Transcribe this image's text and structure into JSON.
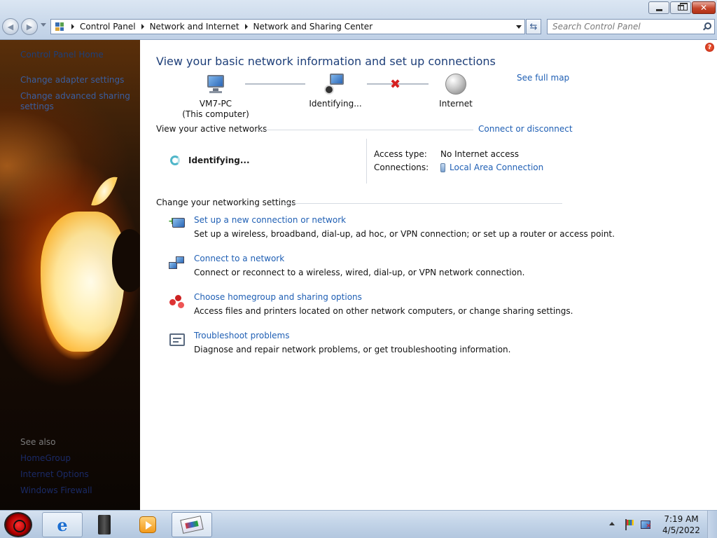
{
  "window": {
    "minimize_icon": "minimize-icon",
    "maximize_icon": "restore-icon",
    "close_icon": "close-icon",
    "close_glyph": "✕"
  },
  "address_bar": {
    "breadcrumbs": [
      "Control Panel",
      "Network and Internet",
      "Network and Sharing Center"
    ],
    "search_placeholder": "Search Control Panel"
  },
  "sidebar": {
    "home": "Control Panel Home",
    "links": [
      "Change adapter settings",
      "Change advanced sharing settings"
    ],
    "see_also_heading": "See also",
    "see_also": [
      "HomeGroup",
      "Internet Options",
      "Windows Firewall"
    ]
  },
  "main": {
    "title": "View your basic network information and set up connections",
    "see_full_map": "See full map",
    "map": {
      "computer_name": "VM7-PC",
      "computer_sub": "(This computer)",
      "middle": "Identifying...",
      "internet": "Internet",
      "broken_link_glyph": "✖"
    },
    "active_networks_heading": "View your active networks",
    "connect_or_disconnect": "Connect or disconnect",
    "active_network_status": "Identifying...",
    "access_type_label": "Access type:",
    "access_type_value": "No Internet access",
    "connections_label": "Connections:",
    "connections_value": "Local Area Connection",
    "settings_heading": "Change your networking settings",
    "tasks": [
      {
        "title": "Set up a new connection or network",
        "desc": "Set up a wireless, broadband, dial-up, ad hoc, or VPN connection; or set up a router or access point."
      },
      {
        "title": "Connect to a network",
        "desc": "Connect or reconnect to a wireless, wired, dial-up, or VPN network connection."
      },
      {
        "title": "Choose homegroup and sharing options",
        "desc": "Access files and printers located on other network computers, or change sharing settings."
      },
      {
        "title": "Troubleshoot problems",
        "desc": "Diagnose and repair network problems, or get troubleshooting information."
      }
    ]
  },
  "taskbar": {
    "ie_glyph": "e",
    "time": "7:19 AM",
    "date": "4/5/2022"
  },
  "colors": {
    "link": "#1f5fb4",
    "title_text": "#1e3f79",
    "error": "#d62020"
  }
}
